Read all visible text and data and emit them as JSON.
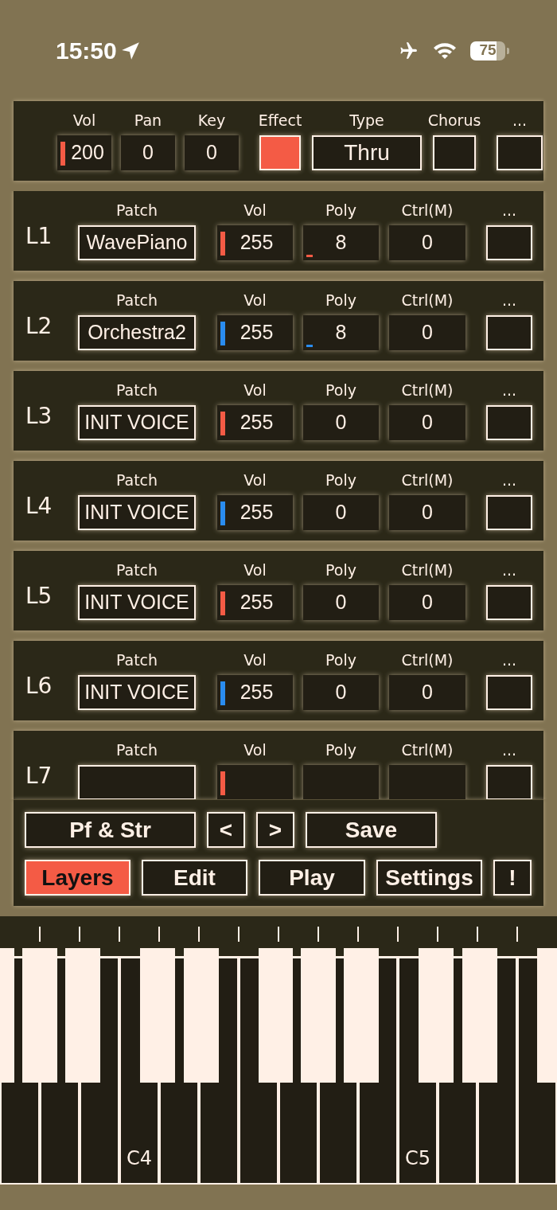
{
  "status_bar": {
    "time": "15:50",
    "battery": "75"
  },
  "master": [
    {
      "kind": "meter",
      "label": "Vol",
      "value": "200",
      "color": "#f45b45"
    },
    {
      "kind": "number",
      "label": "Pan",
      "value": "0"
    },
    {
      "kind": "number",
      "label": "Key",
      "value": "0"
    },
    {
      "kind": "toggle",
      "label": "Effect",
      "on": true
    },
    {
      "kind": "select",
      "label": "Type",
      "value": "Thru"
    },
    {
      "kind": "toggle",
      "label": "Chorus",
      "on": false
    },
    {
      "kind": "blank",
      "label": "..."
    }
  ],
  "layers": [
    {
      "name": "L1",
      "headers": [
        "Patch",
        "Vol",
        "Poly",
        "Ctrl(M)",
        "..."
      ],
      "patch": "WavePiano",
      "vol": "255",
      "color": "#f45b45",
      "poly": {
        "value": "8",
        "level": 0.08
      },
      "ctrl": "0"
    },
    {
      "name": "L2",
      "headers": [
        "Patch",
        "Vol",
        "Poly",
        "Ctrl(M)",
        "..."
      ],
      "patch": "Orchestra2",
      "vol": "255",
      "color": "#2a8cf0",
      "poly": {
        "value": "8",
        "level": 0.08
      },
      "ctrl": "0"
    },
    {
      "name": "L3",
      "headers": [
        "Patch",
        "Vol",
        "Poly",
        "Ctrl(M)",
        "..."
      ],
      "patch": "INIT VOICE",
      "vol": "255",
      "color": "#f45b45",
      "poly": {
        "value": "0"
      },
      "ctrl": "0"
    },
    {
      "name": "L4",
      "headers": [
        "Patch",
        "Vol",
        "Poly",
        "Ctrl(M)",
        "..."
      ],
      "patch": "INIT VOICE",
      "vol": "255",
      "color": "#2a8cf0",
      "poly": {
        "value": "0"
      },
      "ctrl": "0"
    },
    {
      "name": "L5",
      "headers": [
        "Patch",
        "Vol",
        "Poly",
        "Ctrl(M)",
        "..."
      ],
      "patch": "INIT VOICE",
      "vol": "255",
      "color": "#f45b45",
      "poly": {
        "value": "0"
      },
      "ctrl": "0"
    },
    {
      "name": "L6",
      "headers": [
        "Patch",
        "Vol",
        "Poly",
        "Ctrl(M)",
        "..."
      ],
      "patch": "INIT VOICE",
      "vol": "255",
      "color": "#2a8cf0",
      "poly": {
        "value": "0"
      },
      "ctrl": "0"
    },
    {
      "name": "L7",
      "headers": [
        "Patch",
        "Vol",
        "Poly",
        "Ctrl(M)",
        "..."
      ],
      "color": "#f45b45"
    }
  ],
  "preset": {
    "name": "Pf & Str",
    "prev": "<",
    "next": ">",
    "save": "Save"
  },
  "tabs": [
    {
      "label": "Layers",
      "selected": true
    },
    {
      "label": "Edit",
      "selected": false
    },
    {
      "label": "Play",
      "selected": false
    },
    {
      "label": "Settings",
      "selected": false
    }
  ],
  "info_button": "!",
  "keyboard": {
    "labels": [
      "C4",
      "C5"
    ]
  }
}
